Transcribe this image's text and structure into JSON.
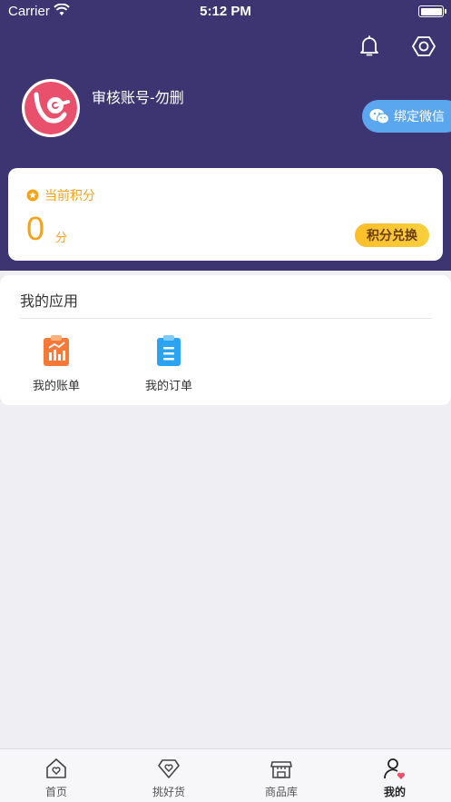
{
  "status_bar": {
    "carrier": "Carrier",
    "time": "5:12 PM"
  },
  "profile": {
    "username": "审核账号-勿删",
    "bind_wechat_label": "绑定微信"
  },
  "points": {
    "title": "当前积分",
    "value": "0",
    "unit": "分",
    "exchange_label": "积分兑换"
  },
  "apps": {
    "title": "我的应用",
    "items": [
      {
        "label": "我的账单",
        "icon": "bill-icon"
      },
      {
        "label": "我的订单",
        "icon": "order-icon"
      }
    ]
  },
  "tab_bar": {
    "items": [
      {
        "label": "首页",
        "icon": "home-icon",
        "active": false
      },
      {
        "label": "挑好货",
        "icon": "diamond-icon",
        "active": false
      },
      {
        "label": "商品库",
        "icon": "store-icon",
        "active": false
      },
      {
        "label": "我的",
        "icon": "user-icon",
        "active": true
      }
    ]
  },
  "colors": {
    "header_bg": "#3d3572",
    "accent_orange": "#f4a31c",
    "wechat_blue": "#5aa7ef",
    "page_bg": "#efeef2"
  }
}
